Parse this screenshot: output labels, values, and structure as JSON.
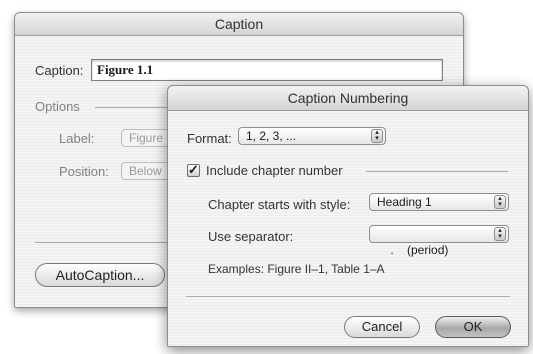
{
  "caption_dialog": {
    "title": "Caption",
    "caption_label": "Caption:",
    "caption_value": "Figure 1.1",
    "options_label": "Options",
    "label_label": "Label:",
    "label_value": "Figure",
    "position_label": "Position:",
    "position_value": "Below",
    "autocaption_button": "AutoCaption..."
  },
  "numbering_dialog": {
    "title": "Caption Numbering",
    "format_label": "Format:",
    "format_value": "1, 2, 3, ...",
    "include_chapter_label": "Include chapter number",
    "include_chapter_checked": true,
    "chapter_style_label": "Chapter starts with style:",
    "chapter_style_value": "Heading 1",
    "separator_label": "Use separator:",
    "separator_value": ".    (period)",
    "examples_text": "Examples:  Figure II–1, Table 1–A",
    "cancel_button": "Cancel",
    "ok_button": "OK"
  }
}
